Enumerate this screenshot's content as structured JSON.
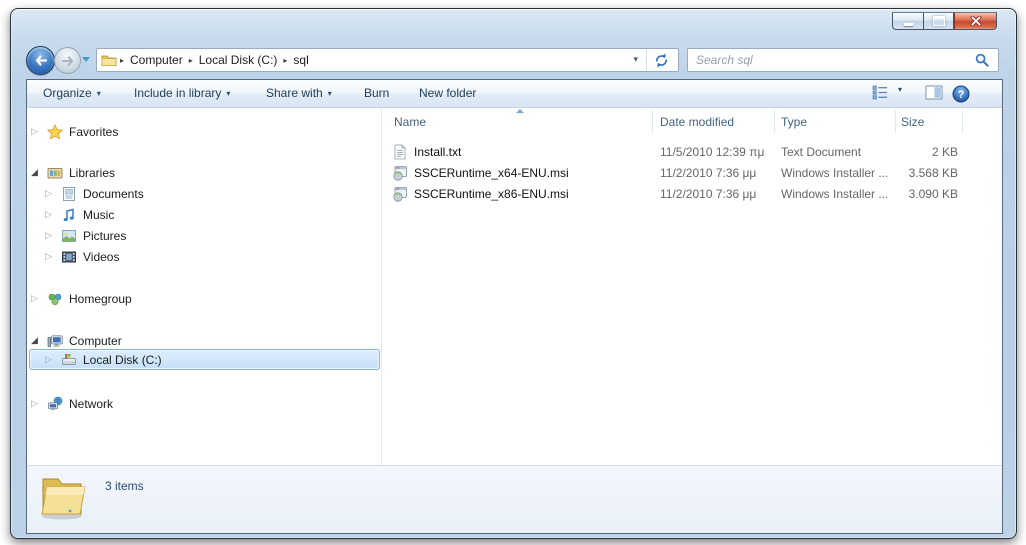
{
  "colors": {
    "frame_glass": "#bfd4e9",
    "close_button_red": "#c94a2f",
    "selection_border": "#7fb2e3",
    "selection_fill": "#cde3f8",
    "toolbar_text": "#1e3c5a",
    "header_text": "#44627f",
    "secondary_text": "#666666",
    "status_text": "#2b4d72"
  },
  "icons": {
    "chevron": "▸",
    "dropdown": "▾",
    "expander_collapsed": "▷",
    "expander_expanded": "◢",
    "help_glyph": "?"
  },
  "window": {
    "controls": [
      {
        "name": "minimize"
      },
      {
        "name": "maximize"
      },
      {
        "name": "close"
      }
    ]
  },
  "navigation": {
    "breadcrumb": [
      "Computer",
      "Local Disk (C:)",
      "sql"
    ]
  },
  "search": {
    "placeholder": "Search sql"
  },
  "toolbar": {
    "items": [
      {
        "label": "Organize",
        "dropdown": true
      },
      {
        "label": "Include in library",
        "dropdown": true
      },
      {
        "label": "Share with",
        "dropdown": true
      },
      {
        "label": "Burn",
        "dropdown": false
      },
      {
        "label": "New folder",
        "dropdown": false
      }
    ]
  },
  "sidebar": {
    "items": [
      {
        "label": "Favorites",
        "icon": "star-icon",
        "expander": "collapsed",
        "level": 0,
        "selected": false
      },
      {
        "label": "Libraries",
        "icon": "libraries-icon",
        "expander": "expanded",
        "level": 0,
        "selected": false
      },
      {
        "label": "Documents",
        "icon": "documents-icon",
        "expander": "collapsed",
        "level": 1,
        "selected": false
      },
      {
        "label": "Music",
        "icon": "music-icon",
        "expander": "collapsed",
        "level": 1,
        "selected": false
      },
      {
        "label": "Pictures",
        "icon": "pictures-icon",
        "expander": "collapsed",
        "level": 1,
        "selected": false
      },
      {
        "label": "Videos",
        "icon": "videos-icon",
        "expander": "collapsed",
        "level": 1,
        "selected": false
      },
      {
        "label": "Homegroup",
        "icon": "homegroup-icon",
        "expander": "collapsed",
        "level": 0,
        "selected": false
      },
      {
        "label": "Computer",
        "icon": "computer-icon",
        "expander": "expanded",
        "level": 0,
        "selected": false
      },
      {
        "label": "Local Disk (C:)",
        "icon": "disk-icon",
        "expander": "collapsed",
        "level": 1,
        "selected": true
      },
      {
        "label": "Network",
        "icon": "network-icon",
        "expander": "collapsed",
        "level": 0,
        "selected": false
      }
    ]
  },
  "file_list": {
    "columns": [
      "Name",
      "Date modified",
      "Type",
      "Size"
    ],
    "sort": {
      "column": "Name",
      "direction": "ascending"
    },
    "rows": [
      {
        "name": "Install.txt",
        "date": "11/5/2010 12:39 πμ",
        "type": "Text Document",
        "size": "2 KB",
        "icon": "text-document-icon"
      },
      {
        "name": "SSCERuntime_x64-ENU.msi",
        "date": "11/2/2010 7:36 μμ",
        "type": "Windows Installer ...",
        "size": "3.568 KB",
        "icon": "installer-icon"
      },
      {
        "name": "SSCERuntime_x86-ENU.msi",
        "date": "11/2/2010 7:36 μμ",
        "type": "Windows Installer ...",
        "size": "3.090 KB",
        "icon": "installer-icon"
      }
    ]
  },
  "status_bar": {
    "text": "3 items"
  }
}
